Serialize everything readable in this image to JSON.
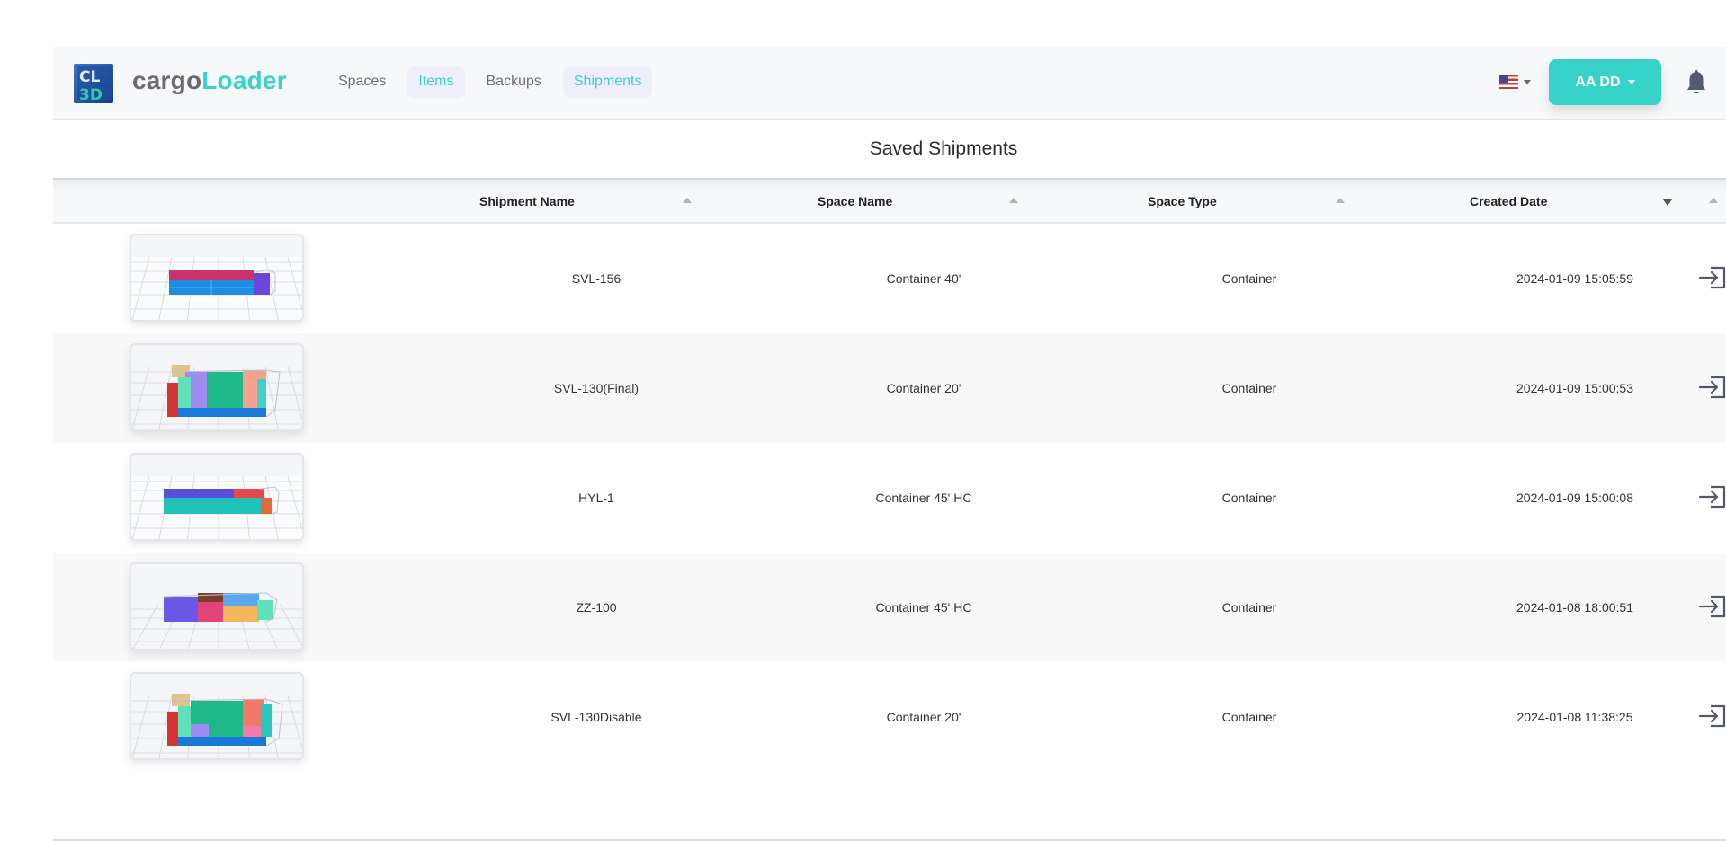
{
  "app": {
    "logo_icon": "cl3d-cube-logo",
    "logo_text_part1": "cargo",
    "logo_text_part2": "Loader",
    "brand_color": "#3ad3c6"
  },
  "nav": {
    "items": [
      {
        "label": "Spaces",
        "active": false
      },
      {
        "label": "Items",
        "active": true
      },
      {
        "label": "Backups",
        "active": false
      },
      {
        "label": "Shipments",
        "active": true
      }
    ]
  },
  "header_right": {
    "language_icon": "us-flag-icon",
    "user_label": "AA DD",
    "notification_icon": "bell-icon"
  },
  "page": {
    "title": "Saved Shipments"
  },
  "table": {
    "columns": [
      {
        "label": "",
        "key": "thumbnail"
      },
      {
        "label": "Shipment Name",
        "sort": "none"
      },
      {
        "label": "Space Name",
        "sort": "none"
      },
      {
        "label": "Space Type",
        "sort": "none"
      },
      {
        "label": "Created Date",
        "sort": "descending"
      },
      {
        "label": "",
        "sort": "none"
      }
    ],
    "rows": [
      {
        "shipment_name": "SVL-156",
        "space_name": "Container 40'",
        "space_type": "Container",
        "created_date": "2024-01-09 15:05:59",
        "action_icon": "open-icon"
      },
      {
        "shipment_name": "SVL-130(Final)",
        "space_name": "Container 20'",
        "space_type": "Container",
        "created_date": "2024-01-09 15:00:53",
        "action_icon": "open-icon"
      },
      {
        "shipment_name": "HYL-1",
        "space_name": "Container 45' HC",
        "space_type": "Container",
        "created_date": "2024-01-09 15:00:08",
        "action_icon": "open-icon"
      },
      {
        "shipment_name": "ZZ-100",
        "space_name": "Container 45' HC",
        "space_type": "Container",
        "created_date": "2024-01-08 18:00:51",
        "action_icon": "open-icon"
      },
      {
        "shipment_name": "SVL-130Disable",
        "space_name": "Container 20'",
        "space_type": "Container",
        "created_date": "2024-01-08 11:38:25",
        "action_icon": "open-icon"
      }
    ]
  }
}
